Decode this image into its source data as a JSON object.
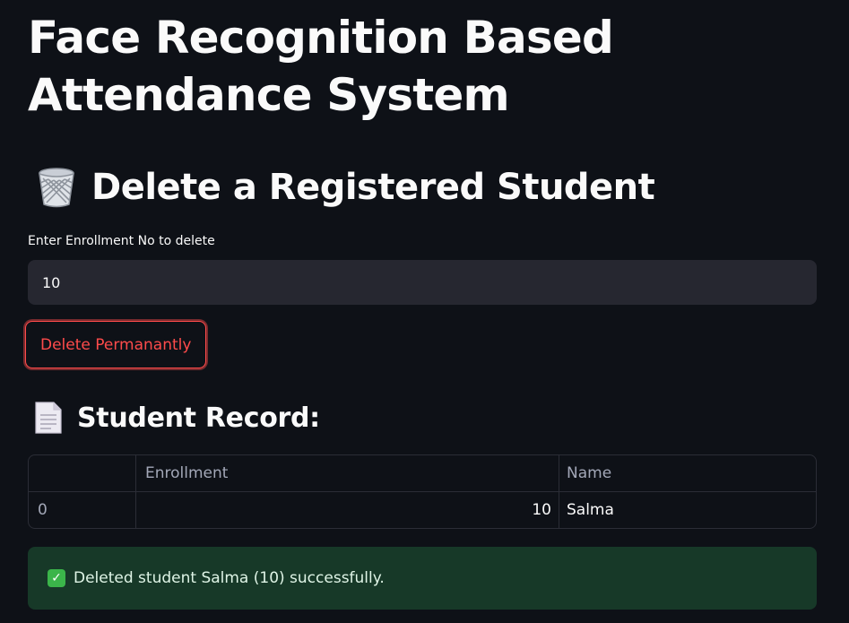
{
  "page": {
    "title": "Face Recognition Based Attendance System"
  },
  "delete_section": {
    "icon": "wastebasket-icon",
    "title": "Delete a Registered Student",
    "input_label": "Enter Enrollment No to delete",
    "input_value": "10",
    "delete_button_label": "Delete Permanantly",
    "button_color": "#ff4b4b"
  },
  "record": {
    "icon": "page-facing-up-icon",
    "title": "Student Record:",
    "columns": [
      "",
      "Enrollment",
      "Name"
    ],
    "rows": [
      {
        "index": "0",
        "enrollment": "10",
        "name": "Salma"
      }
    ]
  },
  "alert": {
    "icon": "check-mark-button-icon",
    "message": "Deleted student Salma (10) successfully.",
    "background_color": "#173928"
  },
  "theme": {
    "background": "#0e1117",
    "input_background": "#262730",
    "text": "#fafafa"
  }
}
